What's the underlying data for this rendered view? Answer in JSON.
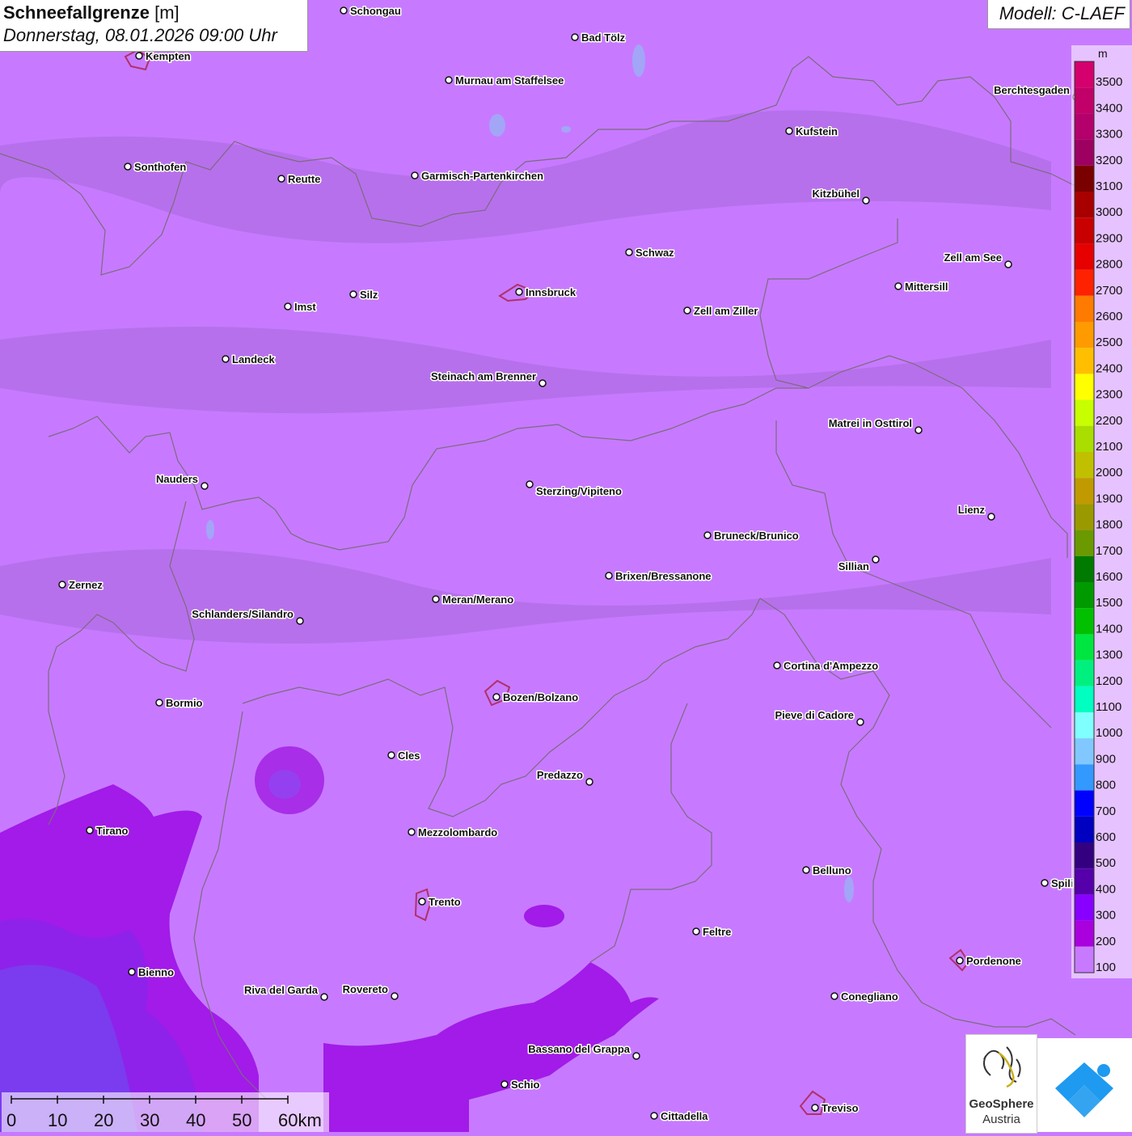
{
  "header": {
    "title": "Schneefallgrenze",
    "unit": "[m]",
    "datetime": "Donnerstag, 08.01.2026 09:00 Uhr",
    "model": "Modell: C-LAEF"
  },
  "legend": {
    "unit": "m",
    "items": [
      {
        "value": "3500",
        "color": "#d5006d"
      },
      {
        "value": "3400",
        "color": "#c2006a"
      },
      {
        "value": "3300",
        "color": "#b4006c"
      },
      {
        "value": "3200",
        "color": "#9e0062"
      },
      {
        "value": "3100",
        "color": "#7a0000"
      },
      {
        "value": "3000",
        "color": "#a80000"
      },
      {
        "value": "2900",
        "color": "#c80000"
      },
      {
        "value": "2800",
        "color": "#e60000"
      },
      {
        "value": "2700",
        "color": "#ff2200"
      },
      {
        "value": "2600",
        "color": "#ff7a00"
      },
      {
        "value": "2500",
        "color": "#ff9a00"
      },
      {
        "value": "2400",
        "color": "#ffbf00"
      },
      {
        "value": "2300",
        "color": "#ffff00"
      },
      {
        "value": "2200",
        "color": "#c8ff00"
      },
      {
        "value": "2100",
        "color": "#aadd00"
      },
      {
        "value": "2000",
        "color": "#c0c000"
      },
      {
        "value": "1900",
        "color": "#c09a00"
      },
      {
        "value": "1800",
        "color": "#9a9a00"
      },
      {
        "value": "1700",
        "color": "#6a9a00"
      },
      {
        "value": "1600",
        "color": "#007a00"
      },
      {
        "value": "1500",
        "color": "#009a00"
      },
      {
        "value": "1400",
        "color": "#00c000"
      },
      {
        "value": "1300",
        "color": "#00e640"
      },
      {
        "value": "1200",
        "color": "#00f080"
      },
      {
        "value": "1100",
        "color": "#00ffc0"
      },
      {
        "value": "1000",
        "color": "#80ffff"
      },
      {
        "value": "900",
        "color": "#80c8ff"
      },
      {
        "value": "800",
        "color": "#3399ff"
      },
      {
        "value": "700",
        "color": "#0000ff"
      },
      {
        "value": "600",
        "color": "#0000c0"
      },
      {
        "value": "500",
        "color": "#330080"
      },
      {
        "value": "400",
        "color": "#5500aa"
      },
      {
        "value": "300",
        "color": "#8800ff"
      },
      {
        "value": "200",
        "color": "#aa00dd"
      },
      {
        "value": "100",
        "color": "#c77aff"
      }
    ]
  },
  "scale_bar": {
    "ticks": [
      "0",
      "10",
      "20",
      "30",
      "40",
      "50",
      "60km"
    ]
  },
  "logos": {
    "geosphere_line1": "GeoSphere",
    "geosphere_line2": "Austria"
  },
  "cities": [
    {
      "name": "Schongau"
    },
    {
      "name": "Bad Tölz"
    },
    {
      "name": "Kempten"
    },
    {
      "name": "Murnau am Staffelsee"
    },
    {
      "name": "Berchtesgaden"
    },
    {
      "name": "Kufstein"
    },
    {
      "name": "Sonthofen"
    },
    {
      "name": "Reutte"
    },
    {
      "name": "Garmisch-Partenkirchen"
    },
    {
      "name": "Kitzbühel"
    },
    {
      "name": "Schwaz"
    },
    {
      "name": "Zell am See"
    },
    {
      "name": "Innsbruck"
    },
    {
      "name": "Mittersill"
    },
    {
      "name": "Imst"
    },
    {
      "name": "Silz"
    },
    {
      "name": "Zell am Ziller"
    },
    {
      "name": "Landeck"
    },
    {
      "name": "Steinach am Brenner"
    },
    {
      "name": "Matrei in Osttirol"
    },
    {
      "name": "Nauders"
    },
    {
      "name": "Sterzing/Vipiteno"
    },
    {
      "name": "Lienz"
    },
    {
      "name": "Bruneck/Brunico"
    },
    {
      "name": "Sillian"
    },
    {
      "name": "Zernez"
    },
    {
      "name": "Brixen/Bressanone"
    },
    {
      "name": "Meran/Merano"
    },
    {
      "name": "Schlanders/Silandro"
    },
    {
      "name": "Cortina d'Ampezzo"
    },
    {
      "name": "Bormio"
    },
    {
      "name": "Bozen/Bolzano"
    },
    {
      "name": "Pieve di Cadore"
    },
    {
      "name": "Cles"
    },
    {
      "name": "Predazzo"
    },
    {
      "name": "Tirano"
    },
    {
      "name": "Mezzolombardo"
    },
    {
      "name": "Belluno"
    },
    {
      "name": "Spili"
    },
    {
      "name": "Trento"
    },
    {
      "name": "Feltre"
    },
    {
      "name": "Pordenone"
    },
    {
      "name": "Bienno"
    },
    {
      "name": "Riva del Garda"
    },
    {
      "name": "Rovereto"
    },
    {
      "name": "Conegliano"
    },
    {
      "name": "Bassano del Grappa"
    },
    {
      "name": "Schio"
    },
    {
      "name": "Treviso"
    },
    {
      "name": "Cittadella"
    }
  ]
}
